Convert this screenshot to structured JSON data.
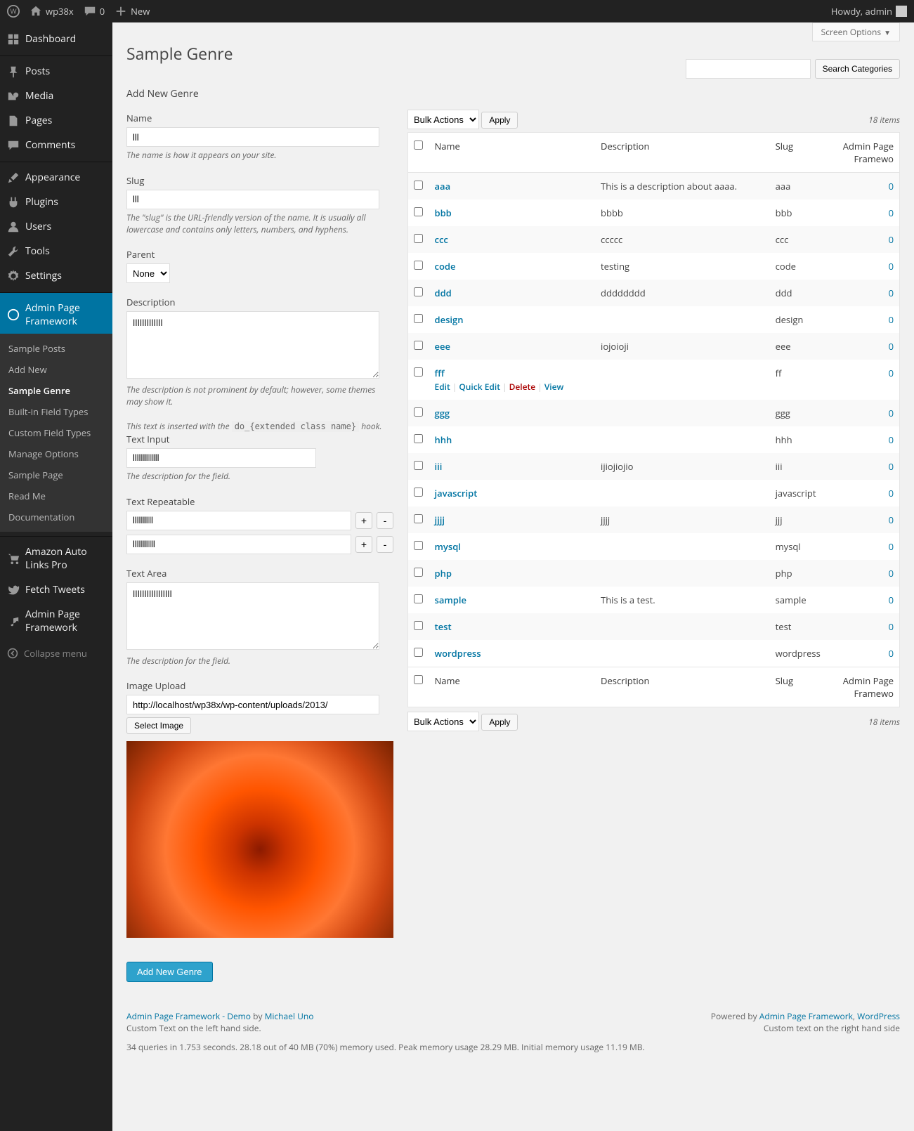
{
  "adminbar": {
    "site": "wp38x",
    "comments": "0",
    "new": "New",
    "howdy": "Howdy, admin"
  },
  "sidebar": {
    "items": [
      {
        "label": "Dashboard",
        "icon": "dashboard"
      },
      {
        "label": "Posts",
        "icon": "pin",
        "sep": true
      },
      {
        "label": "Media",
        "icon": "media"
      },
      {
        "label": "Pages",
        "icon": "page"
      },
      {
        "label": "Comments",
        "icon": "comment"
      },
      {
        "label": "Appearance",
        "icon": "brush",
        "sep": true
      },
      {
        "label": "Plugins",
        "icon": "plug"
      },
      {
        "label": "Users",
        "icon": "user"
      },
      {
        "label": "Tools",
        "icon": "wrench"
      },
      {
        "label": "Settings",
        "icon": "gear"
      },
      {
        "label": "Admin Page Framework",
        "icon": "wp",
        "sep": true,
        "active": true
      },
      {
        "label": "Amazon Auto Links Pro",
        "icon": "cart",
        "sep": true
      },
      {
        "label": "Fetch Tweets",
        "icon": "bird"
      },
      {
        "label": "Admin Page Framework",
        "icon": "music"
      }
    ],
    "submenu": [
      "Sample Posts",
      "Add New",
      "Sample Genre",
      "Built-in Field Types",
      "Custom Field Types",
      "Manage Options",
      "Sample Page",
      "Read Me",
      "Documentation"
    ],
    "submenu_current": 2,
    "collapse": "Collapse menu"
  },
  "header": {
    "screen_options": "Screen Options",
    "title": "Sample Genre",
    "search_button": "Search Categories"
  },
  "form": {
    "add_heading": "Add New Genre",
    "name_label": "Name",
    "name_value": "lll",
    "name_desc": "The name is how it appears on your site.",
    "slug_label": "Slug",
    "slug_value": "lll",
    "slug_desc": "The \"slug\" is the URL-friendly version of the name. It is usually all lowercase and contains only letters, numbers, and hyphens.",
    "parent_label": "Parent",
    "parent_value": "None",
    "desc_label": "Description",
    "desc_value": "lllllllllllll",
    "desc_desc": "The description is not prominent by default; however, some themes may show it.",
    "hook_note_pre": "This text is inserted with the ",
    "hook_code": "do_{extended class name}",
    "hook_note_post": " hook.",
    "textinput_label": "Text Input",
    "textinput_value": "lllllllllllll",
    "textinput_desc": "The description for the field.",
    "repeat_label": "Text Repeatable",
    "repeat1": "llllllllll",
    "repeat2": "lllllllllll",
    "textarea_label": "Text Area",
    "textarea_value": "lllllllllllllllll",
    "textarea_desc": "The description for the field.",
    "image_label": "Image Upload",
    "image_url": "http://localhost/wp38x/wp-content/uploads/2013/",
    "select_image": "Select Image",
    "submit": "Add New Genre"
  },
  "table": {
    "bulk": "Bulk Actions",
    "apply": "Apply",
    "count": "18 items",
    "cols": {
      "name": "Name",
      "description": "Description",
      "slug": "Slug",
      "posts": "Admin Page Framewo"
    },
    "row_actions": {
      "edit": "Edit",
      "quick": "Quick Edit",
      "delete": "Delete",
      "view": "View"
    },
    "rows": [
      {
        "name": "aaa",
        "desc": "This is a description about aaaa.",
        "slug": "aaa",
        "count": "0"
      },
      {
        "name": "bbb",
        "desc": "bbbb",
        "slug": "bbb",
        "count": "0"
      },
      {
        "name": "ccc",
        "desc": "ccccc",
        "slug": "ccc",
        "count": "0"
      },
      {
        "name": "code",
        "desc": "testing",
        "slug": "code",
        "count": "0"
      },
      {
        "name": "ddd",
        "desc": "dddddddd",
        "slug": "ddd",
        "count": "0"
      },
      {
        "name": "design",
        "desc": "",
        "slug": "design",
        "count": "0"
      },
      {
        "name": "eee",
        "desc": "iojoioji",
        "slug": "eee",
        "count": "0"
      },
      {
        "name": "fff",
        "desc": "",
        "slug": "ff",
        "count": "0",
        "actions": true
      },
      {
        "name": "ggg",
        "desc": "",
        "slug": "ggg",
        "count": "0"
      },
      {
        "name": "hhh",
        "desc": "",
        "slug": "hhh",
        "count": "0"
      },
      {
        "name": "iii",
        "desc": "ijiojiojio",
        "slug": "iii",
        "count": "0"
      },
      {
        "name": "javascript",
        "desc": "",
        "slug": "javascript",
        "count": "0"
      },
      {
        "name": "jjjj",
        "desc": "jjjj",
        "slug": "jjj",
        "count": "0"
      },
      {
        "name": "mysql",
        "desc": "",
        "slug": "mysql",
        "count": "0"
      },
      {
        "name": "php",
        "desc": "",
        "slug": "php",
        "count": "0"
      },
      {
        "name": "sample",
        "desc": "This is a test.",
        "slug": "sample",
        "count": "0"
      },
      {
        "name": "test",
        "desc": "",
        "slug": "test",
        "count": "0"
      },
      {
        "name": "wordpress",
        "desc": "",
        "slug": "wordpress",
        "count": "0"
      }
    ]
  },
  "footer": {
    "left_link": "Admin Page Framework - Demo",
    "by": " by ",
    "author": "Michael Uno",
    "left_custom": "Custom Text on the left hand side.",
    "right_pre": "Powered by ",
    "right_link1": "Admin Page Framework",
    "right_sep": ", ",
    "right_link2": "WordPress",
    "right_custom": "Custom text on the right hand side",
    "stats": "34 queries in 1.753 seconds.    28.18 out of 40 MB (70%) memory used.    Peak memory usage 28.29 MB.    Initial memory usage 11.19 MB."
  }
}
